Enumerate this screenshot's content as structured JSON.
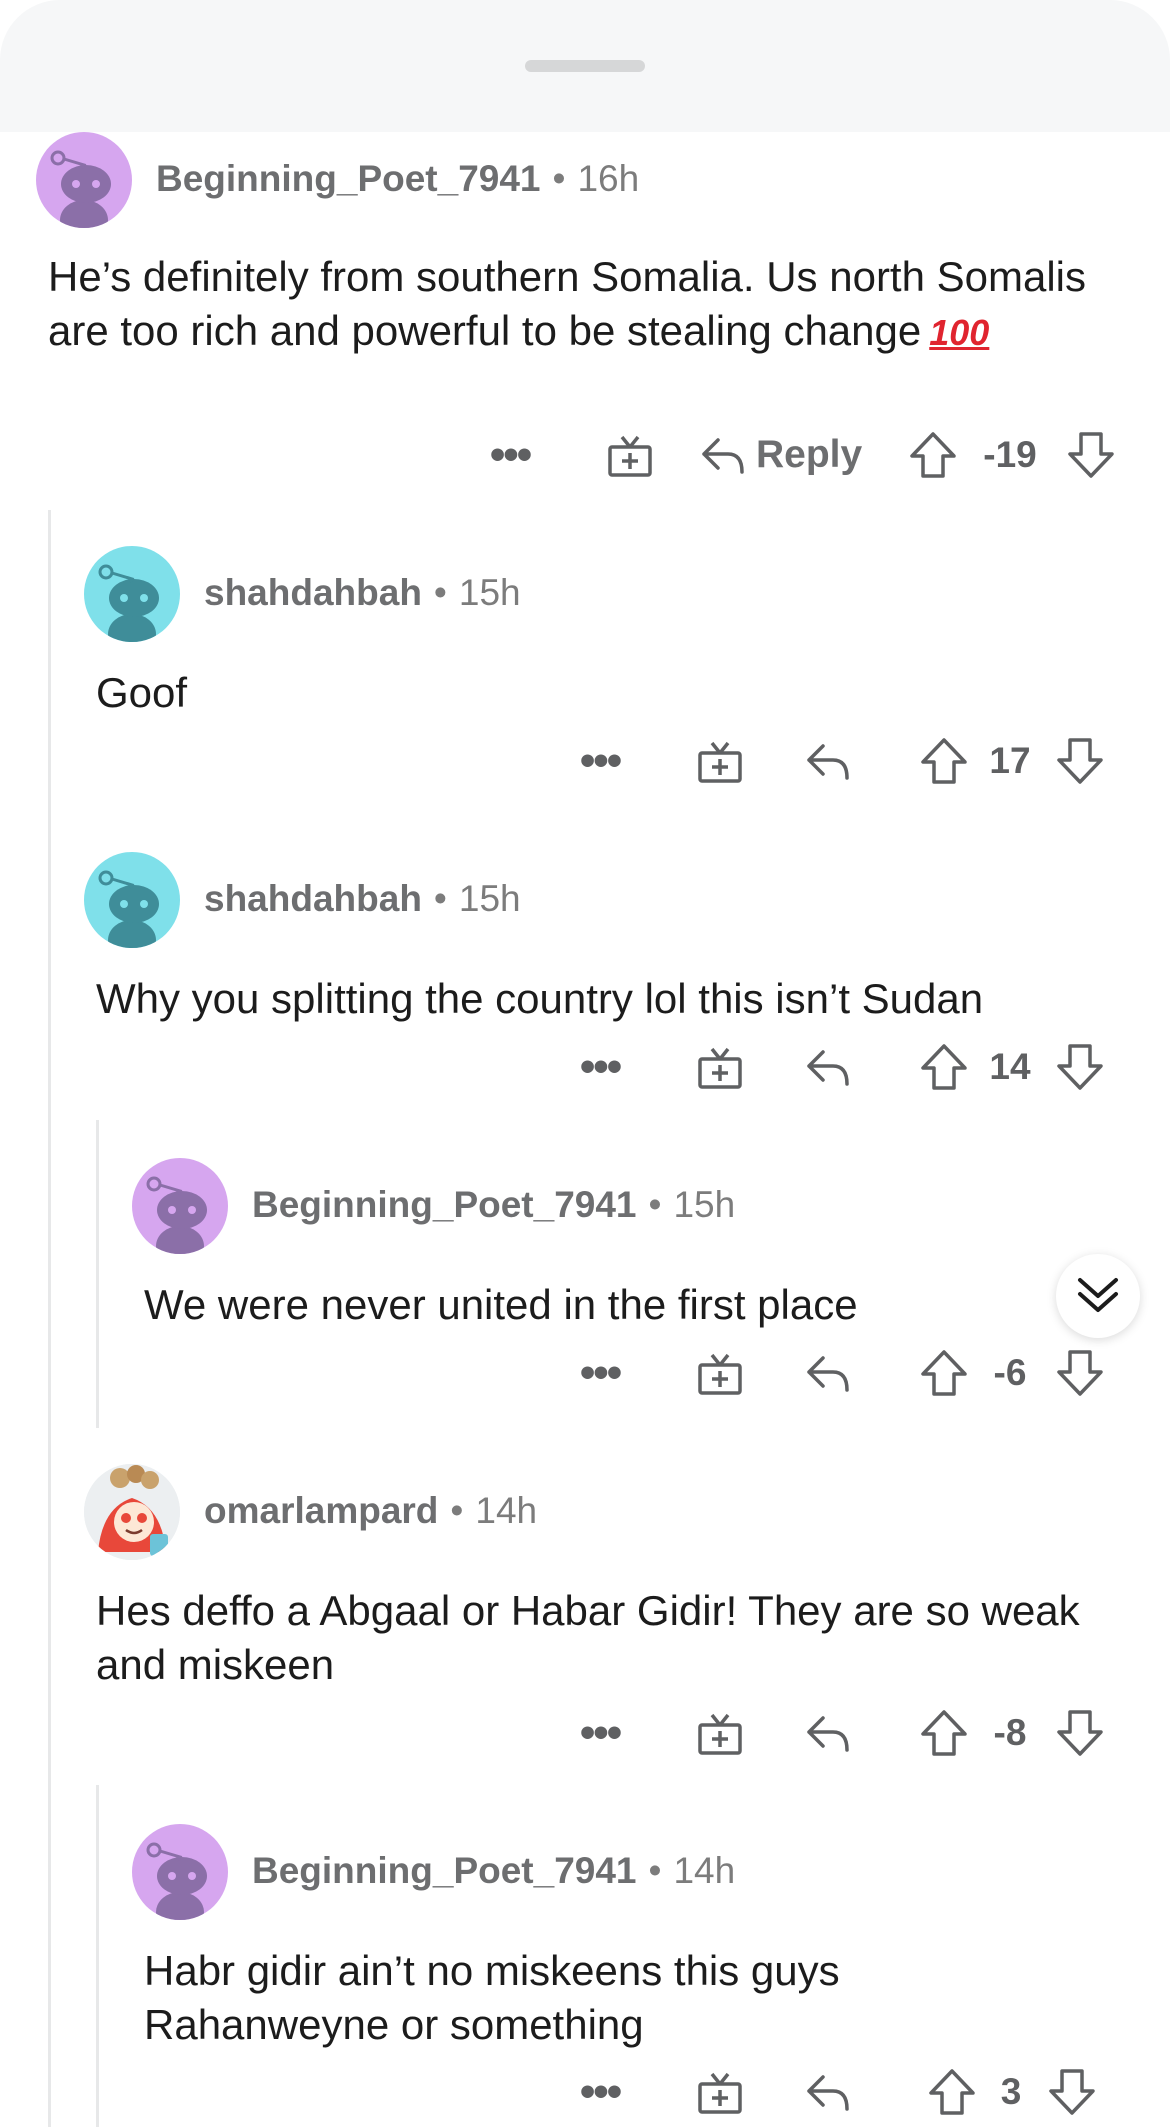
{
  "sheet": {
    "handle": "drag-handle"
  },
  "colors": {
    "purple_avatar": "#d6a6ef",
    "purple_snoo": "#8b6fa8",
    "teal_avatar": "#7fe0ea",
    "teal_snoo": "#3f8d99",
    "thread_line": "#e7e8e9",
    "meta_text": "#7c7c7c"
  },
  "comments": [
    {
      "username": "Beginning_Poet_7941",
      "separator": "•",
      "time": "16h",
      "body": "He’s definitely from southern Somalia. Us north Somalis are too rich and powerful to be stealing change",
      "emoji": "💯",
      "more": "•••",
      "reply_label": "Reply",
      "score": "-19",
      "icons": [
        "more-icon",
        "award-icon",
        "reply-icon",
        "upvote-icon",
        "downvote-icon"
      ]
    },
    {
      "username": "shahdahbah",
      "separator": "•",
      "time": "15h",
      "body": "Goof",
      "more": "•••",
      "score": "17"
    },
    {
      "username": "shahdahbah",
      "separator": "•",
      "time": "15h",
      "body": "Why you splitting the country lol this isn’t Sudan",
      "more": "•••",
      "score": "14"
    },
    {
      "username": "Beginning_Poet_7941",
      "separator": "•",
      "time": "15h",
      "body": "We were never united in the first place",
      "more": "•••",
      "score": "-6"
    },
    {
      "username": "omarlampard",
      "separator": "•",
      "time": "14h",
      "body": "Hes deffo a Abgaal or Habar Gidir! They are so weak and miskeen",
      "more": "•••",
      "score": "-8"
    },
    {
      "username": "Beginning_Poet_7941",
      "separator": "•",
      "time": "14h",
      "body": "Habr gidir ain’t no miskeens this guys Rahanweyne or something",
      "more": "•••",
      "score": "3"
    }
  ],
  "floating": {
    "collapse_icon": "chevron-double-down-icon"
  }
}
